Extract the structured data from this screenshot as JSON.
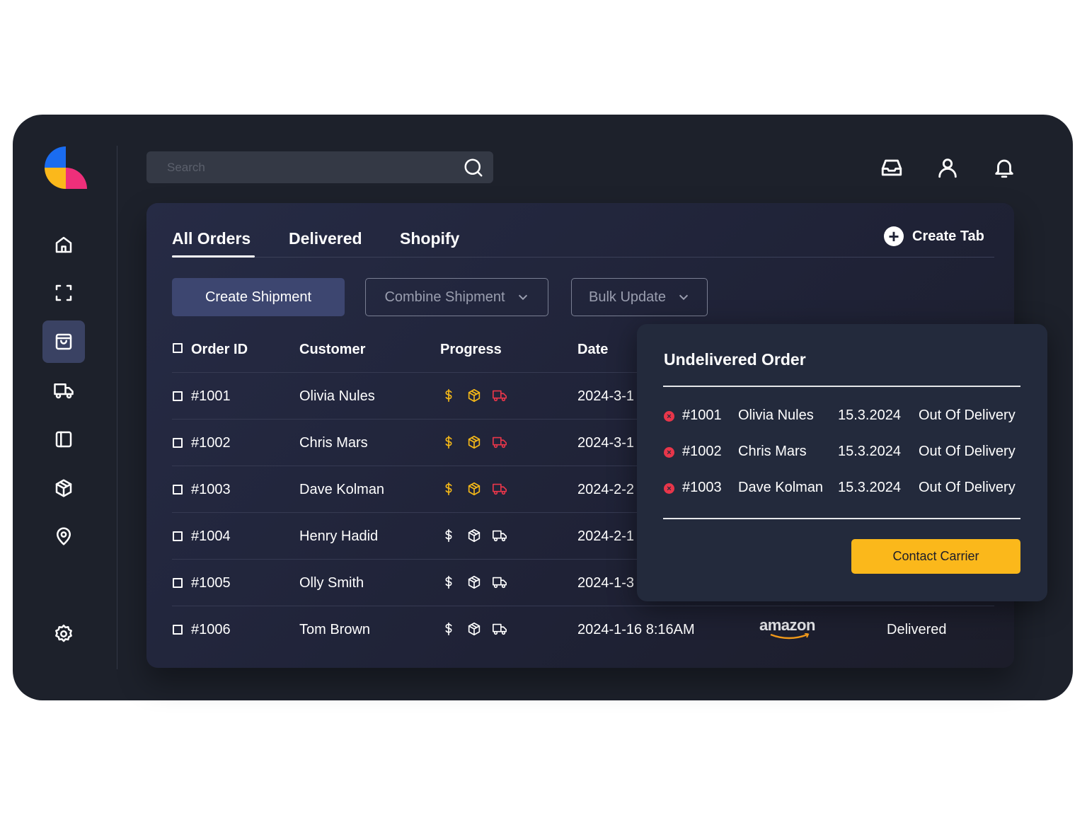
{
  "search": {
    "placeholder": "Search"
  },
  "sidebar": {
    "items": [
      {
        "icon": "home-icon"
      },
      {
        "icon": "scan-icon"
      },
      {
        "icon": "shopping-bag-icon",
        "active": true
      },
      {
        "icon": "truck-icon"
      },
      {
        "icon": "sidebar-layout-icon"
      },
      {
        "icon": "package-icon"
      },
      {
        "icon": "map-pin-icon"
      },
      {
        "icon": "settings-icon"
      }
    ]
  },
  "topbar": {
    "icons": [
      "inbox-icon",
      "user-icon",
      "bell-icon"
    ]
  },
  "tabs": [
    {
      "label": "All Orders",
      "active": true
    },
    {
      "label": "Delivered"
    },
    {
      "label": "Shopify"
    }
  ],
  "create_tab": "Create Tab",
  "actions": {
    "create_shipment": "Create Shipment",
    "combine_shipment": "Combine Shipment",
    "bulk_update": "Bulk Update"
  },
  "table": {
    "headers": {
      "order_id": "Order ID",
      "customer": "Customer",
      "progress": "Progress",
      "date": "Date"
    },
    "rows": [
      {
        "id": "#1001",
        "customer": "Olivia Nules",
        "date": "2024-3-1",
        "progress": "pending"
      },
      {
        "id": "#1002",
        "customer": "Chris Mars",
        "date": "2024-3-1",
        "progress": "pending"
      },
      {
        "id": "#1003",
        "customer": "Dave Kolman",
        "date": "2024-2-2",
        "progress": "pending"
      },
      {
        "id": "#1004",
        "customer": "Henry Hadid",
        "date": "2024-2-1",
        "progress": "done"
      },
      {
        "id": "#1005",
        "customer": "Olly Smith",
        "date": "2024-1-3",
        "progress": "done"
      },
      {
        "id": "#1006",
        "customer": "Tom Brown",
        "date": "2024-1-16 8:16AM",
        "progress": "done",
        "carrier": "amazon",
        "status": "Delivered"
      }
    ]
  },
  "popup": {
    "title": "Undelivered Order",
    "rows": [
      {
        "id": "#1001",
        "customer": "Olivia Nules",
        "date": "15.3.2024",
        "status": "Out Of Delivery"
      },
      {
        "id": "#1002",
        "customer": "Chris Mars",
        "date": "15.3.2024",
        "status": "Out Of Delivery"
      },
      {
        "id": "#1003",
        "customer": "Dave Kolman",
        "date": "15.3.2024",
        "status": "Out Of Delivery"
      }
    ],
    "contact_button": "Contact Carrier"
  },
  "colors": {
    "background": "#1d212b",
    "accent": "#fbb81b",
    "alert": "#e8364a",
    "pending_dollar": "#f5b818",
    "pending_truck": "#e8364a",
    "primary_button": "#3d4670"
  }
}
